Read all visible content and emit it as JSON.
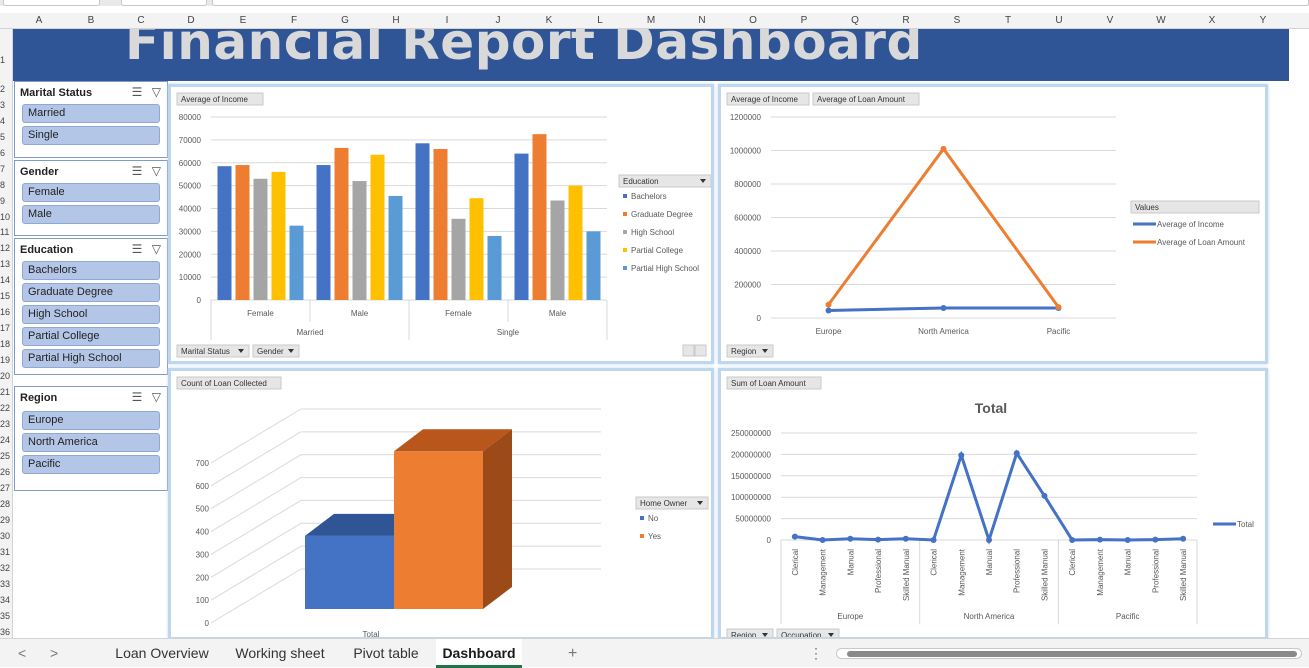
{
  "title": "Financial Report Dashboard",
  "columns": [
    "A",
    "B",
    "C",
    "D",
    "E",
    "F",
    "G",
    "H",
    "I",
    "J",
    "K",
    "L",
    "M",
    "N",
    "O",
    "P",
    "Q",
    "R",
    "S",
    "T",
    "U",
    "V",
    "W",
    "X",
    "Y"
  ],
  "rows": [
    "1",
    "2",
    "3",
    "4",
    "5",
    "6",
    "7",
    "8",
    "9",
    "10",
    "11",
    "12",
    "13",
    "14",
    "15",
    "16",
    "17",
    "18",
    "19",
    "20",
    "21",
    "22",
    "23",
    "24",
    "25",
    "26",
    "27",
    "28",
    "29",
    "30",
    "31",
    "32",
    "33",
    "34",
    "35",
    "36"
  ],
  "slicers": [
    {
      "title": "Marital Status",
      "items": [
        "Married",
        "Single"
      ]
    },
    {
      "title": "Gender",
      "items": [
        "Female",
        "Male"
      ]
    },
    {
      "title": "Education",
      "items": [
        "Bachelors",
        "Graduate Degree",
        "High School",
        "Partial College",
        "Partial High School"
      ]
    },
    {
      "title": "Region",
      "items": [
        "Europe",
        "North America",
        "Pacific"
      ]
    }
  ],
  "tabs": [
    "Loan Overview",
    "Working sheet",
    "Pivot table",
    "Dashboard"
  ],
  "active_tab": "Dashboard",
  "add_sheet": "+",
  "nav": {
    "prev": "<",
    "next": ">",
    "more": "⋮"
  },
  "colors": {
    "bachelors": "#4472c4",
    "graduate": "#ed7d31",
    "highschool": "#a5a5a5",
    "partialcollege": "#ffc000",
    "partialhigh": "#5b9bd5",
    "banner": "#2f5597"
  },
  "chart_data": [
    {
      "type": "bar",
      "field_label": "Average of Income",
      "legend_title": "Education",
      "filter_buttons": [
        "Marital Status",
        "Gender"
      ],
      "groups": [
        "Married",
        "Married",
        "Single",
        "Single"
      ],
      "categories": [
        "Female",
        "Male",
        "Female",
        "Male"
      ],
      "group_labels": [
        "Married",
        "Single"
      ],
      "ylim": [
        0,
        80000
      ],
      "yticks": [
        0,
        10000,
        20000,
        30000,
        40000,
        50000,
        60000,
        70000,
        80000
      ],
      "ytick_labels": [
        "0",
        "10000",
        "20000",
        "30000",
        "40000",
        "50000",
        "60000",
        "70000",
        "80000"
      ],
      "series": [
        {
          "name": "Bachelors",
          "values": [
            58500,
            59000,
            68500,
            64000
          ]
        },
        {
          "name": "Graduate Degree",
          "values": [
            59000,
            66500,
            66000,
            72500
          ]
        },
        {
          "name": "High School",
          "values": [
            53000,
            52000,
            35500,
            43500
          ]
        },
        {
          "name": "Partial College",
          "values": [
            56000,
            63500,
            44500,
            50000
          ]
        },
        {
          "name": "Partial High School",
          "values": [
            32500,
            45500,
            28000,
            30000
          ]
        }
      ]
    },
    {
      "type": "line",
      "field_labels": [
        "Average of Income",
        "Average of Loan Amount"
      ],
      "legend_title": "Values",
      "filter_buttons": [
        "Region"
      ],
      "categories": [
        "Europe",
        "North America",
        "Pacific"
      ],
      "ylim": [
        0,
        1200000
      ],
      "ytick_labels": [
        "0",
        "200000",
        "400000",
        "600000",
        "800000",
        "1000000",
        "1200000"
      ],
      "series": [
        {
          "name": "Average of Income",
          "values": [
            45000,
            60000,
            60000
          ]
        },
        {
          "name": "Average of Loan Amount",
          "values": [
            80000,
            1010000,
            65000
          ]
        }
      ]
    },
    {
      "type": "bar",
      "field_label": "Count of Loan Collected",
      "legend_title": "Home Owner",
      "x_label": "Total",
      "ylim": [
        0,
        700
      ],
      "ytick_labels": [
        "0",
        "100",
        "200",
        "300",
        "400",
        "500",
        "600",
        "700"
      ],
      "series": [
        {
          "name": "No",
          "values": [
            320
          ]
        },
        {
          "name": "Yes",
          "values": [
            690
          ]
        }
      ]
    },
    {
      "type": "line",
      "field_label": "Sum of Loan Amount",
      "title": "Total",
      "filter_buttons": [
        "Region",
        "Occupation"
      ],
      "groups": [
        "Europe",
        "North America",
        "Pacific"
      ],
      "categories": [
        "Clerical",
        "Management",
        "Manual",
        "Professional",
        "Skilled Manual",
        "Clerical",
        "Management",
        "Manual",
        "Professional",
        "Skilled Manual",
        "Clerical",
        "Management",
        "Manual",
        "Professional",
        "Skilled Manual"
      ],
      "ylim": [
        0,
        250000000
      ],
      "ytick_labels": [
        "0",
        "50000000",
        "100000000",
        "150000000",
        "200000000",
        "250000000"
      ],
      "series": [
        {
          "name": "Total",
          "values": [
            8000000,
            0,
            3000000,
            1000000,
            3000000,
            0,
            198000000,
            0,
            203000000,
            103000000,
            0,
            1000000,
            0,
            1000000,
            3000000
          ]
        }
      ]
    }
  ]
}
